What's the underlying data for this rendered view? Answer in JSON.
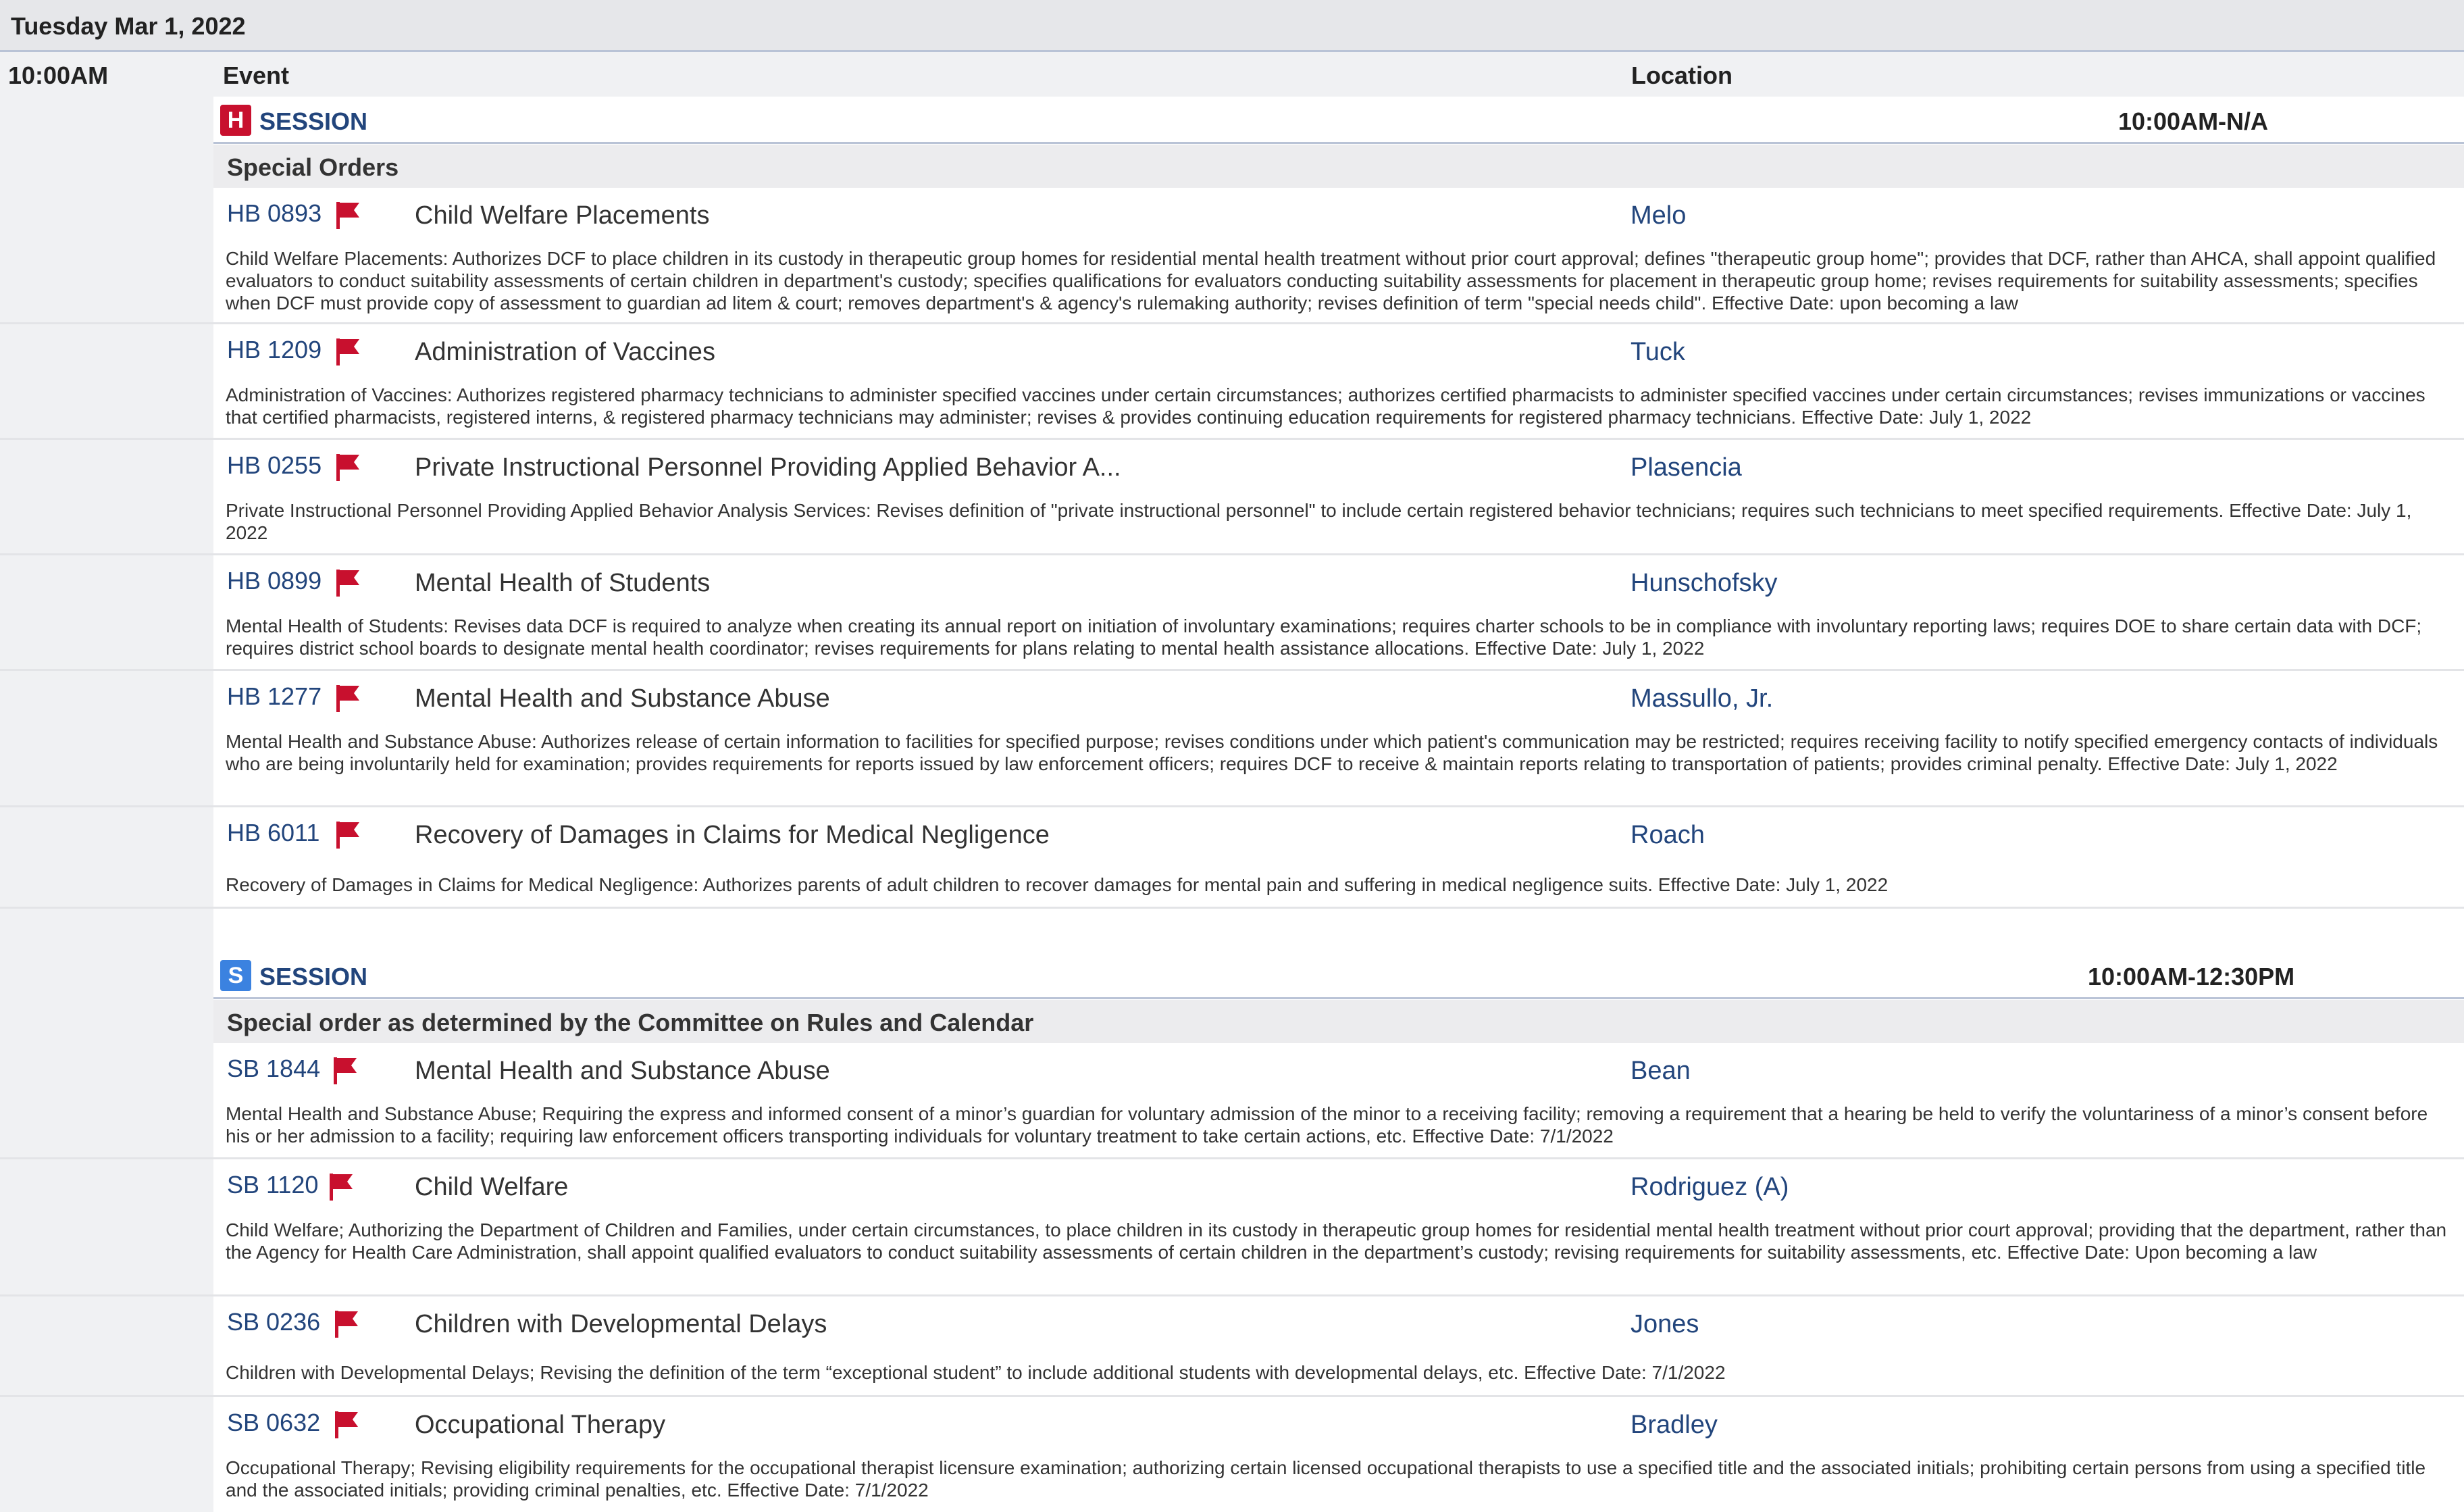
{
  "date_label": "Tuesday Mar 1, 2022",
  "time_label": "10:00AM",
  "columns": {
    "event": "Event",
    "location": "Location"
  },
  "sessions": [
    {
      "badge": "H",
      "badge_color": "#c8102e",
      "label": "SESSION",
      "time_range": "10:00AM-N/A",
      "group_title": "Special Orders",
      "bills": [
        {
          "number": "HB 0893",
          "title": "Child Welfare Placements",
          "sponsor": "Melo",
          "description": "Child Welfare Placements: Authorizes DCF to place children in its custody in therapeutic group homes for residential mental health treatment without prior court approval; defines \"therapeutic group home\"; provides that DCF, rather than AHCA, shall appoint qualified evaluators to conduct suitability assessments of certain children in department's custody; specifies qualifications for evaluators conducting suitability assessments for placement in therapeutic group home; revises requirements for suitability assessments; specifies when DCF must provide copy of assessment to guardian ad litem & court; removes department's & agency's rulemaking authority; revises definition of term \"special needs child\". Effective Date: upon becoming a law"
        },
        {
          "number": "HB 1209",
          "title": "Administration of Vaccines",
          "sponsor": "Tuck",
          "description": "Administration of Vaccines: Authorizes registered pharmacy technicians to administer specified vaccines under certain circumstances; authorizes certified pharmacists to administer specified vaccines under certain circumstances; revises immunizations or vaccines that certified pharmacists, registered interns, & registered pharmacy technicians may administer; revises & provides continuing education requirements for registered pharmacy technicians. Effective Date: July 1, 2022"
        },
        {
          "number": "HB 0255",
          "title": "Private Instructional Personnel Providing Applied Behavior A...",
          "sponsor": "Plasencia",
          "description": "Private Instructional Personnel Providing Applied Behavior Analysis Services: Revises definition of \"private instructional personnel\" to include certain registered behavior technicians; requires such technicians to meet specified requirements. Effective Date: July 1, 2022"
        },
        {
          "number": "HB 0899",
          "title": "Mental Health of Students",
          "sponsor": "Hunschofsky",
          "description": "Mental Health of Students: Revises data DCF is required to analyze when creating its annual report on initiation of involuntary examinations; requires charter schools to be in compliance with involuntary reporting laws; requires DOE to share certain data with DCF; requires district school boards to designate mental health coordinator; revises requirements for plans relating to mental health assistance allocations. Effective Date: July 1, 2022"
        },
        {
          "number": "HB 1277",
          "title": "Mental Health and Substance Abuse",
          "sponsor": "Massullo, Jr.",
          "description": "Mental Health and Substance Abuse: Authorizes release of certain information to facilities for specified purpose; revises conditions under which patient's communication may be restricted; requires receiving facility to notify specified emergency contacts of individuals who are being involuntarily held for examination; provides requirements for reports issued by law enforcement officers; requires DCF to receive & maintain reports relating to transportation of patients; provides criminal penalty. Effective Date: July 1, 2022"
        },
        {
          "number": "HB 6011",
          "title": "Recovery of Damages in Claims for Medical Negligence",
          "sponsor": "Roach",
          "description": "Recovery of Damages in Claims for Medical Negligence: Authorizes parents of adult children to recover damages for mental pain and suffering in medical negligence suits. Effective Date: July 1, 2022"
        }
      ]
    },
    {
      "badge": "S",
      "badge_color": "#3b82e0",
      "label": "SESSION",
      "time_range": "10:00AM-12:30PM",
      "group_title": "Special order as determined by the Committee on Rules and Calendar",
      "bills": [
        {
          "number": "SB 1844",
          "title": "Mental Health and Substance Abuse",
          "sponsor": "Bean",
          "description": "Mental Health and Substance Abuse; Requiring the express and informed consent of a minor’s guardian for voluntary admission of the minor to a receiving facility; removing a requirement that a hearing be held to verify the voluntariness of a minor’s consent before his or her admission to a facility; requiring law enforcement officers transporting individuals for voluntary treatment to take certain actions, etc. Effective Date: 7/1/2022"
        },
        {
          "number": "SB 1120",
          "title": "Child Welfare",
          "sponsor": "Rodriguez (A)",
          "description": "Child Welfare; Authorizing the Department of Children and Families, under certain circumstances, to place children in its custody in therapeutic group homes for residential mental health treatment without prior court approval; providing that the department, rather than the Agency for Health Care Administration, shall appoint qualified evaluators to conduct suitability assessments of certain children in the department’s custody; revising requirements for suitability assessments, etc. Effective Date: Upon becoming a law"
        },
        {
          "number": "SB 0236",
          "title": "Children with Developmental Delays",
          "sponsor": "Jones",
          "description": "Children with Developmental Delays; Revising the definition of the term “exceptional student” to include additional students with developmental delays, etc. Effective Date: 7/1/2022"
        },
        {
          "number": "SB 0632",
          "title": "Occupational Therapy",
          "sponsor": "Bradley",
          "description": "Occupational Therapy; Revising eligibility requirements for the occupational therapist licensure examination; authorizing certain licensed occupational therapists to use a specified title and the associated initials; prohibiting certain persons from using a specified title and the associated initials; providing criminal penalties, etc. Effective Date: 7/1/2022"
        }
      ]
    }
  ]
}
